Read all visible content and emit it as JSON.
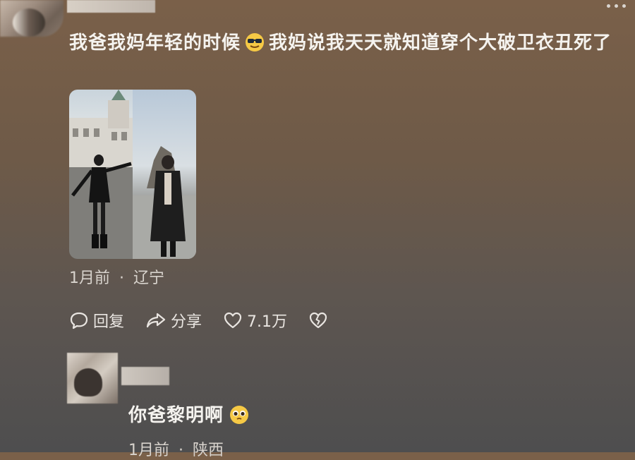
{
  "comment": {
    "text_part1": "我爸我妈年轻的时候",
    "emoji_part1": "cool-sunglasses-emoji",
    "text_part2": "我妈说我天天就知道穿个大破卫衣丑死了",
    "photo_alt": "photo-collage",
    "time": "1月前",
    "separator": "·",
    "location": "辽宁"
  },
  "actions": {
    "reply_label": "回复",
    "share_label": "分享",
    "like_count": "7.1万"
  },
  "reply": {
    "text": "你爸黎明啊",
    "emoji": "pleading-face-emoji",
    "time": "1月前",
    "separator": "·",
    "location": "陕西"
  },
  "colors": {
    "accent_text": "#f5f3ef",
    "meta_text": "#d8d3cd"
  }
}
